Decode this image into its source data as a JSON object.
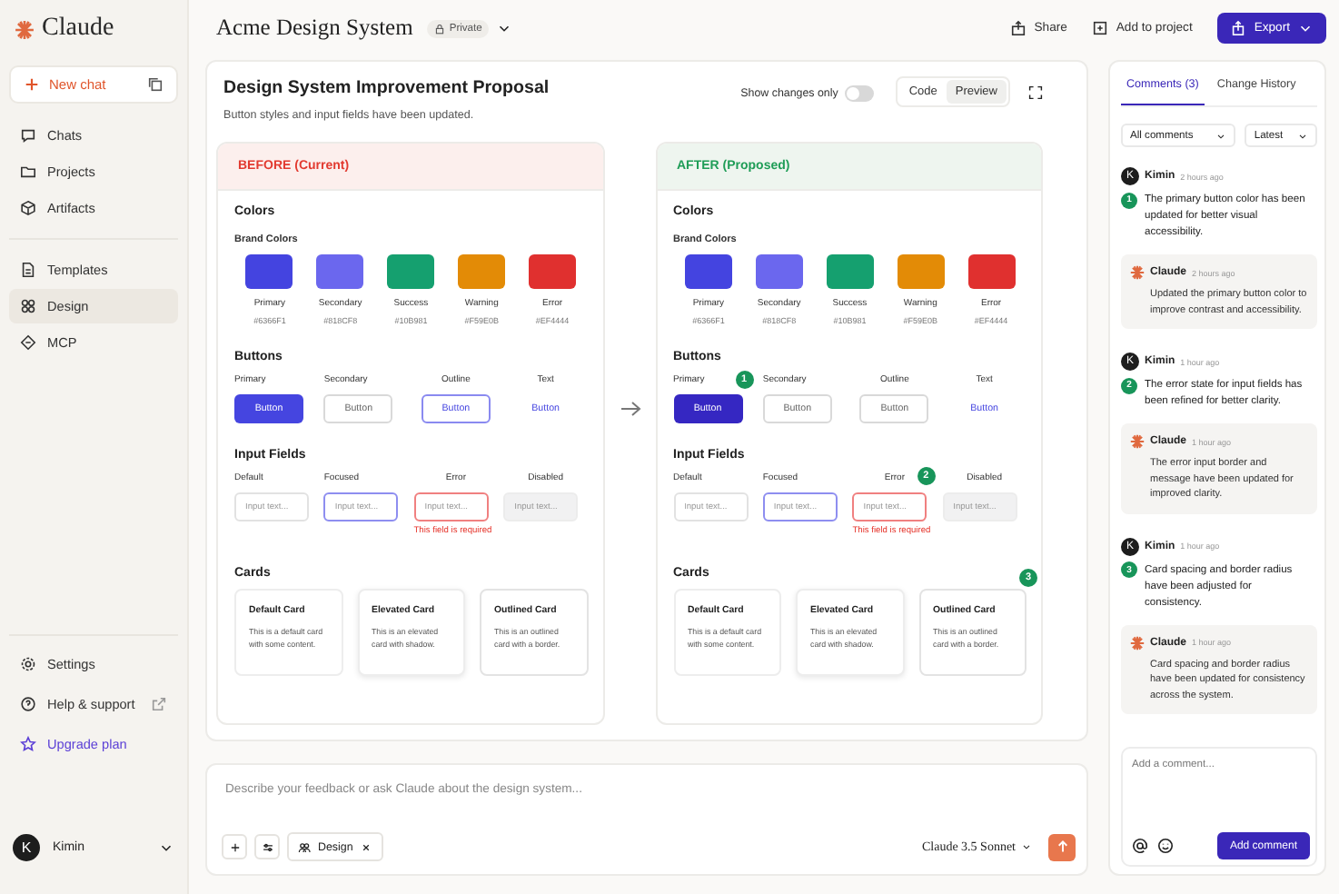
{
  "sidebar": {
    "logo": "Claude",
    "new_chat": "New chat",
    "nav_groups": [
      {
        "items": [
          {
            "label": "Chats",
            "selected": false
          },
          {
            "label": "Projects",
            "selected": false
          },
          {
            "label": "Artifacts",
            "selected": false
          }
        ]
      },
      {
        "items": [
          {
            "label": "Templates",
            "selected": false
          },
          {
            "label": "Design",
            "selected": true
          },
          {
            "label": "MCP",
            "selected": false
          }
        ]
      }
    ],
    "bottom": [
      {
        "label": "Settings",
        "kind": "settings"
      },
      {
        "label": "Help & support",
        "kind": "external"
      },
      {
        "label": "Upgrade plan",
        "kind": "upgrade"
      }
    ],
    "user": {
      "initial": "K",
      "name": "Kimin"
    }
  },
  "header": {
    "title": "Acme Design System",
    "visibility": "Private",
    "actions": [
      "Share",
      "Add to project"
    ],
    "export": "Export"
  },
  "proposal": {
    "title": "Design System Improvement Proposal",
    "subtitle": "Button styles and input fields have been updated.",
    "show_changes_only": {
      "label": "Show changes only",
      "on": false
    },
    "view_tabs": [
      {
        "label": "Code",
        "selected": false
      },
      {
        "label": "Preview",
        "selected": true
      }
    ],
    "panels": [
      {
        "kind": "before",
        "heading": "BEFORE (Current)",
        "colors_heading": "Colors",
        "brand_heading": "Brand Colors",
        "swatches": [
          {
            "name": "Primary",
            "hex": "#6366F1",
            "color": "#4444e0"
          },
          {
            "name": "Secondary",
            "hex": "#818CF8",
            "color": "#6b67ee"
          },
          {
            "name": "Success",
            "hex": "#10B981",
            "color": "#15a06f"
          },
          {
            "name": "Warning",
            "hex": "#F59E0B",
            "color": "#e38b06"
          },
          {
            "name": "Error",
            "hex": "#EF4444",
            "color": "#e0302f"
          }
        ],
        "buttons_heading": "Buttons",
        "buttons": [
          {
            "label": "Primary",
            "text": "Button",
            "kind": "primary"
          },
          {
            "label": "Secondary",
            "text": "Button",
            "kind": "secondary"
          },
          {
            "label": "Outline",
            "text": "Button",
            "kind": "outline"
          },
          {
            "label": "Text",
            "text": "Button",
            "kind": "text"
          }
        ],
        "inputs_heading": "Input Fields",
        "inputs": [
          {
            "label": "Default",
            "placeholder": "Input text...",
            "kind": "default"
          },
          {
            "label": "Focused",
            "placeholder": "Input text...",
            "kind": "focused"
          },
          {
            "label": "Error",
            "placeholder": "Input text...",
            "kind": "error",
            "error_message": "This field is required"
          },
          {
            "label": "Disabled",
            "placeholder": "Input text...",
            "kind": "disabled"
          }
        ],
        "cards_heading": "Cards",
        "cards": [
          {
            "title": "Default Card",
            "text": "This is a default card with some content.",
            "kind": "default"
          },
          {
            "title": "Elevated Card",
            "text": "This is an elevated card with shadow.",
            "kind": "elevated"
          },
          {
            "title": "Outlined Card",
            "text": "This is an outlined card with a border.",
            "kind": "outlined"
          }
        ]
      },
      {
        "kind": "after",
        "heading": "AFTER (Proposed)",
        "colors_heading": "Colors",
        "brand_heading": "Brand Colors",
        "swatches": [
          {
            "name": "Primary",
            "hex": "#6366F1",
            "color": "#4444e0"
          },
          {
            "name": "Secondary",
            "hex": "#818CF8",
            "color": "#6b67ee"
          },
          {
            "name": "Success",
            "hex": "#10B981",
            "color": "#15a06f"
          },
          {
            "name": "Warning",
            "hex": "#F59E0B",
            "color": "#e38b06"
          },
          {
            "name": "Error",
            "hex": "#EF4444",
            "color": "#e0302f"
          }
        ],
        "buttons_heading": "Buttons",
        "buttons": [
          {
            "label": "Primary",
            "text": "Button",
            "kind": "primary-dark",
            "badge": "1"
          },
          {
            "label": "Secondary",
            "text": "Button",
            "kind": "secondary"
          },
          {
            "label": "Outline",
            "text": "Button",
            "kind": "outline-muted"
          },
          {
            "label": "Text",
            "text": "Button",
            "kind": "text"
          }
        ],
        "inputs_heading": "Input Fields",
        "inputs": [
          {
            "label": "Default",
            "placeholder": "Input text...",
            "kind": "default"
          },
          {
            "label": "Focused",
            "placeholder": "Input text...",
            "kind": "focused"
          },
          {
            "label": "Error",
            "placeholder": "Input text...",
            "kind": "error",
            "error_message": "This field is required",
            "badge": "2"
          },
          {
            "label": "Disabled",
            "placeholder": "Input text...",
            "kind": "disabled"
          }
        ],
        "cards_heading": "Cards",
        "cards_badge": "3",
        "cards": [
          {
            "title": "Default Card",
            "text": "This is a default card with some content.",
            "kind": "default"
          },
          {
            "title": "Elevated Card",
            "text": "This is an elevated card with shadow.",
            "kind": "elevated"
          },
          {
            "title": "Outlined Card",
            "text": "This is an outlined card with a border.",
            "kind": "outlined"
          }
        ]
      }
    ]
  },
  "composer": {
    "placeholder": "Describe your feedback or ask Claude about the design system...",
    "chip": "Design",
    "model": "Claude 3.5 Sonnet"
  },
  "comments": {
    "tabs": [
      {
        "label": "Comments (3)",
        "selected": true
      },
      {
        "label": "Change History",
        "selected": false
      }
    ],
    "filters": [
      "All comments",
      "Latest"
    ],
    "threads": [
      {
        "author": "Kimin",
        "initial": "K",
        "time": "2 hours ago",
        "number": "1",
        "text": "The primary button color has been updated for better visual accessibility.",
        "reply": {
          "author": "Claude",
          "time": "2 hours ago",
          "text": "Updated the primary button color to improve contrast and accessibility."
        }
      },
      {
        "author": "Kimin",
        "initial": "K",
        "time": "1 hour ago",
        "number": "2",
        "text": "The error state for input fields has been refined for better clarity.",
        "reply": {
          "author": "Claude",
          "time": "1 hour ago",
          "text": "The error input border and message have been updated for improved clarity."
        }
      },
      {
        "author": "Kimin",
        "initial": "K",
        "time": "1 hour ago",
        "number": "3",
        "text": "Card spacing and border radius have been adjusted for consistency.",
        "reply": {
          "author": "Claude",
          "time": "1 hour ago",
          "text": "Card spacing and border radius have been updated for consistency across the system."
        }
      }
    ],
    "input_placeholder": "Add a comment...",
    "submit": "Add comment"
  }
}
